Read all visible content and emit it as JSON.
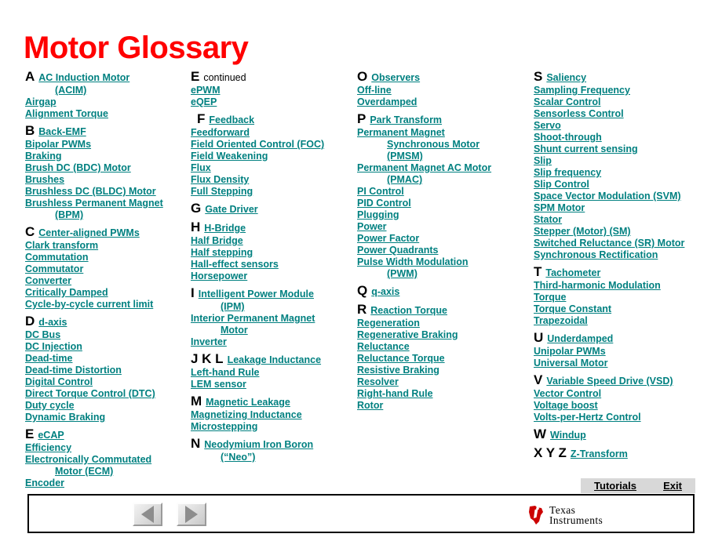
{
  "page": {
    "title": "Motor Glossary",
    "title_color": "#ff0000",
    "link_color": "#008080"
  },
  "columns": [
    {
      "id": "column-a-e",
      "blocks": [
        {
          "letter": "A",
          "term": "AC Induction Motor",
          "link": true,
          "continuations": [
            {
              "text": "(ACIM)",
              "link": true
            }
          ],
          "items": [
            {
              "text": "Airgap",
              "link": true
            },
            {
              "text": "Alignment Torque",
              "link": true
            }
          ]
        },
        {
          "letter": "B",
          "term": "Back-EMF",
          "link": true,
          "continuations": [],
          "items": [
            {
              "text": "Bipolar PWMs",
              "link": true
            },
            {
              "text": "Braking",
              "link": true
            },
            {
              "text": "Brush  DC  (BDC)  Motor",
              "link": true
            },
            {
              "text": "Brushes",
              "link": true
            },
            {
              "text": "Brushless   DC (BLDC)  Motor",
              "link": true
            },
            {
              "text": "Brushless   Permanent Magnet",
              "link": true
            },
            {
              "text": "(BPM)",
              "link": true,
              "indent": true
            }
          ]
        },
        {
          "letter": "C",
          "term": "Center-aligned PWMs",
          "link": true,
          "continuations": [],
          "items": [
            {
              "text": "Clark transform",
              "link": true
            },
            {
              "text": "Commutation",
              "link": true
            },
            {
              "text": "Commutator",
              "link": true
            },
            {
              "text": "Converter",
              "link": true
            },
            {
              "text": "Critically Damped",
              "link": true
            },
            {
              "text": "Cycle-by-cycle  current limit",
              "link": true
            }
          ]
        },
        {
          "letter": "D",
          "term": "d-axis",
          "link": true,
          "continuations": [],
          "items": [
            {
              "text": "DC Bus",
              "link": true
            },
            {
              "text": "DC Injection",
              "link": true
            },
            {
              "text": "Dead-time",
              "link": true
            },
            {
              "text": "Dead-time Distortion",
              "link": true
            },
            {
              "text": "Digital Control",
              "link": true
            },
            {
              "text": "Direct Torque Control (DTC)",
              "link": true
            },
            {
              "text": "Duty  cycle",
              "link": true
            },
            {
              "text": "Dynamic Braking",
              "link": true
            }
          ]
        },
        {
          "letter": "E",
          "term": "eCAP",
          "link": true,
          "continuations": [],
          "items": [
            {
              "text": "Efficiency",
              "link": true
            },
            {
              "text": "Electronically  Commutated",
              "link": true
            },
            {
              "text": "Motor (ECM)",
              "link": true,
              "indent": true
            },
            {
              "text": "Encoder",
              "link": true
            }
          ]
        }
      ]
    },
    {
      "id": "column-e-n",
      "blocks": [
        {
          "letter": "E",
          "term": "continued",
          "link": false,
          "continuations": [],
          "items": [
            {
              "text": "ePWM",
              "link": true
            },
            {
              "text": "eQEP",
              "link": true
            }
          ]
        },
        {
          "letter": "F",
          "term": "Feedback",
          "link": true,
          "indent_letter": true,
          "continuations": [],
          "items": [
            {
              "text": "Feedforward",
              "link": true
            },
            {
              "text": "Field Oriented Control (FOC)",
              "link": true
            },
            {
              "text": "Field Weakening",
              "link": true
            },
            {
              "text": "Flux",
              "link": true
            },
            {
              "text": "Flux Density",
              "link": true
            },
            {
              "text": "Full Stepping",
              "link": true
            }
          ]
        },
        {
          "letter": "G",
          "term": "Gate Driver",
          "link": true,
          "continuations": [],
          "items": []
        },
        {
          "letter": "H",
          "term": "H-Bridge",
          "link": true,
          "continuations": [],
          "items": [
            {
              "text": "Half Bridge",
              "link": true
            },
            {
              "text": "Half stepping",
              "link": true
            },
            {
              "text": "Hall-effect sensors",
              "link": true
            },
            {
              "text": "Horsepower",
              "link": true
            }
          ]
        },
        {
          "letter": "I",
          "term": "Intelligent Power Module",
          "link": true,
          "continuations": [
            {
              "text": "(IPM)",
              "link": true
            }
          ],
          "items": [
            {
              "text": "Interior Permanent Magnet",
              "link": true
            },
            {
              "text": "Motor",
              "link": true,
              "indent": true
            },
            {
              "text": "Inverter",
              "link": true
            }
          ]
        },
        {
          "letter": "J K L",
          "term": "Leakage Inductance",
          "link": true,
          "continuations": [],
          "items": [
            {
              "text": "Left-hand Rule",
              "link": true
            },
            {
              "text": "LEM sensor",
              "link": true
            }
          ]
        },
        {
          "letter": "M",
          "term": "Magnetic Leakage",
          "link": true,
          "continuations": [],
          "items": [
            {
              "text": "Magnetizing Inductance",
              "link": true
            },
            {
              "text": "Microstepping",
              "link": true
            }
          ]
        },
        {
          "letter": "N",
          "term": "Neodymium Iron Boron",
          "link": true,
          "continuations": [
            {
              "text": "(“Neo”)",
              "link": true
            }
          ],
          "items": []
        }
      ]
    },
    {
      "id": "column-o-r",
      "blocks": [
        {
          "letter": "O",
          "term": "Observers",
          "link": true,
          "continuations": [],
          "items": [
            {
              "text": "Off-line",
              "link": true
            },
            {
              "text": "Overdamped",
              "link": true
            }
          ]
        },
        {
          "letter": "P",
          "term": "Park Transform",
          "link": true,
          "continuations": [],
          "items": [
            {
              "text": "Permanent Magnet",
              "link": true
            },
            {
              "text": "Synchronous  Motor",
              "link": true,
              "indent": true
            },
            {
              "text": "(PMSM)",
              "link": true,
              "indent": true
            },
            {
              "text": "Permanent Magnet AC Motor",
              "link": true
            },
            {
              "text": "(PMAC)",
              "link": true,
              "indent": true
            },
            {
              "text": "PI Control",
              "link": true
            },
            {
              "text": "PID Control",
              "link": true
            },
            {
              "text": "Plugging",
              "link": true
            },
            {
              "text": "Power",
              "link": true
            },
            {
              "text": "Power Factor",
              "link": true
            },
            {
              "text": "Power Quadrants",
              "link": true
            },
            {
              "text": "Pulse Width Modulation",
              "link": true
            },
            {
              "text": "(PWM)",
              "link": true,
              "indent": true
            }
          ]
        },
        {
          "letter": "Q",
          "term": "q-axis",
          "link": true,
          "continuations": [],
          "items": []
        },
        {
          "letter": "R",
          "term": "Reaction Torque",
          "link": true,
          "continuations": [],
          "items": [
            {
              "text": "Regeneration",
              "link": true
            },
            {
              "text": "Regenerative Braking",
              "link": true
            },
            {
              "text": "Reluctance",
              "link": true
            },
            {
              "text": "Reluctance Torque",
              "link": true
            },
            {
              "text": "Resistive  Braking",
              "link": true
            },
            {
              "text": "Resolver",
              "link": true
            },
            {
              "text": "Right-hand Rule",
              "link": true
            },
            {
              "text": "Rotor",
              "link": true
            }
          ]
        }
      ]
    },
    {
      "id": "column-s-z",
      "blocks": [
        {
          "letter": "S",
          "term": "Saliency",
          "link": true,
          "continuations": [],
          "items": [
            {
              "text": "Sampling Frequency",
              "link": true
            },
            {
              "text": "Scalar Control",
              "link": true
            },
            {
              "text": "Sensorless  Control",
              "link": true
            },
            {
              "text": "Servo",
              "link": true
            },
            {
              "text": "Shoot-through",
              "link": true
            },
            {
              "text": "Shunt current sensing",
              "link": true
            },
            {
              "text": "Slip",
              "link": true
            },
            {
              "text": "Slip frequency",
              "link": true
            },
            {
              "text": "Slip Control",
              "link": true
            },
            {
              "text": "Space Vector Modulation (SVM)",
              "link": true
            },
            {
              "text": "SPM Motor",
              "link": true
            },
            {
              "text": "Stator",
              "link": true
            },
            {
              "text": "Stepper (Motor) (SM)",
              "link": true
            },
            {
              "text": "Switched Reluctance (SR) Motor",
              "link": true
            },
            {
              "text": "Synchronous  Rectification",
              "link": true
            }
          ]
        },
        {
          "letter": "T",
          "term": "Tachometer",
          "link": true,
          "continuations": [],
          "items": [
            {
              "text": "Third-harmonic Modulation",
              "link": true
            },
            {
              "text": "Torque",
              "link": true
            },
            {
              "text": "Torque Constant",
              "link": true
            },
            {
              "text": "Trapezoidal",
              "link": true
            }
          ]
        },
        {
          "letter": "U",
          "term": "Underdamped",
          "link": true,
          "continuations": [],
          "items": [
            {
              "text": "Unipolar PWMs",
              "link": true
            },
            {
              "text": "Universal Motor",
              "link": true
            }
          ]
        },
        {
          "letter": "V",
          "term": "Variable Speed Drive (VSD)",
          "link": true,
          "continuations": [],
          "items": [
            {
              "text": "Vector Control",
              "link": true
            },
            {
              "text": "Voltage boost",
              "link": true
            },
            {
              "text": "Volts-per-Hertz  Control",
              "link": true
            }
          ]
        },
        {
          "letter": "W",
          "term": "Windup",
          "link": true,
          "continuations": [],
          "items": []
        },
        {
          "letter": "X Y Z",
          "term": "Z-Transform",
          "link": true,
          "continuations": [],
          "items": []
        }
      ]
    }
  ],
  "links_bar": {
    "tutorials_label": "Tutorials",
    "exit_label": "Exit"
  },
  "footer": {
    "prev_icon": "triangle-left-icon",
    "next_icon": "triangle-right-icon",
    "logo": {
      "mark": "ti-texas-icon",
      "line1": "Texas",
      "line2": "Instruments",
      "mark_color": "#cc0000"
    }
  }
}
